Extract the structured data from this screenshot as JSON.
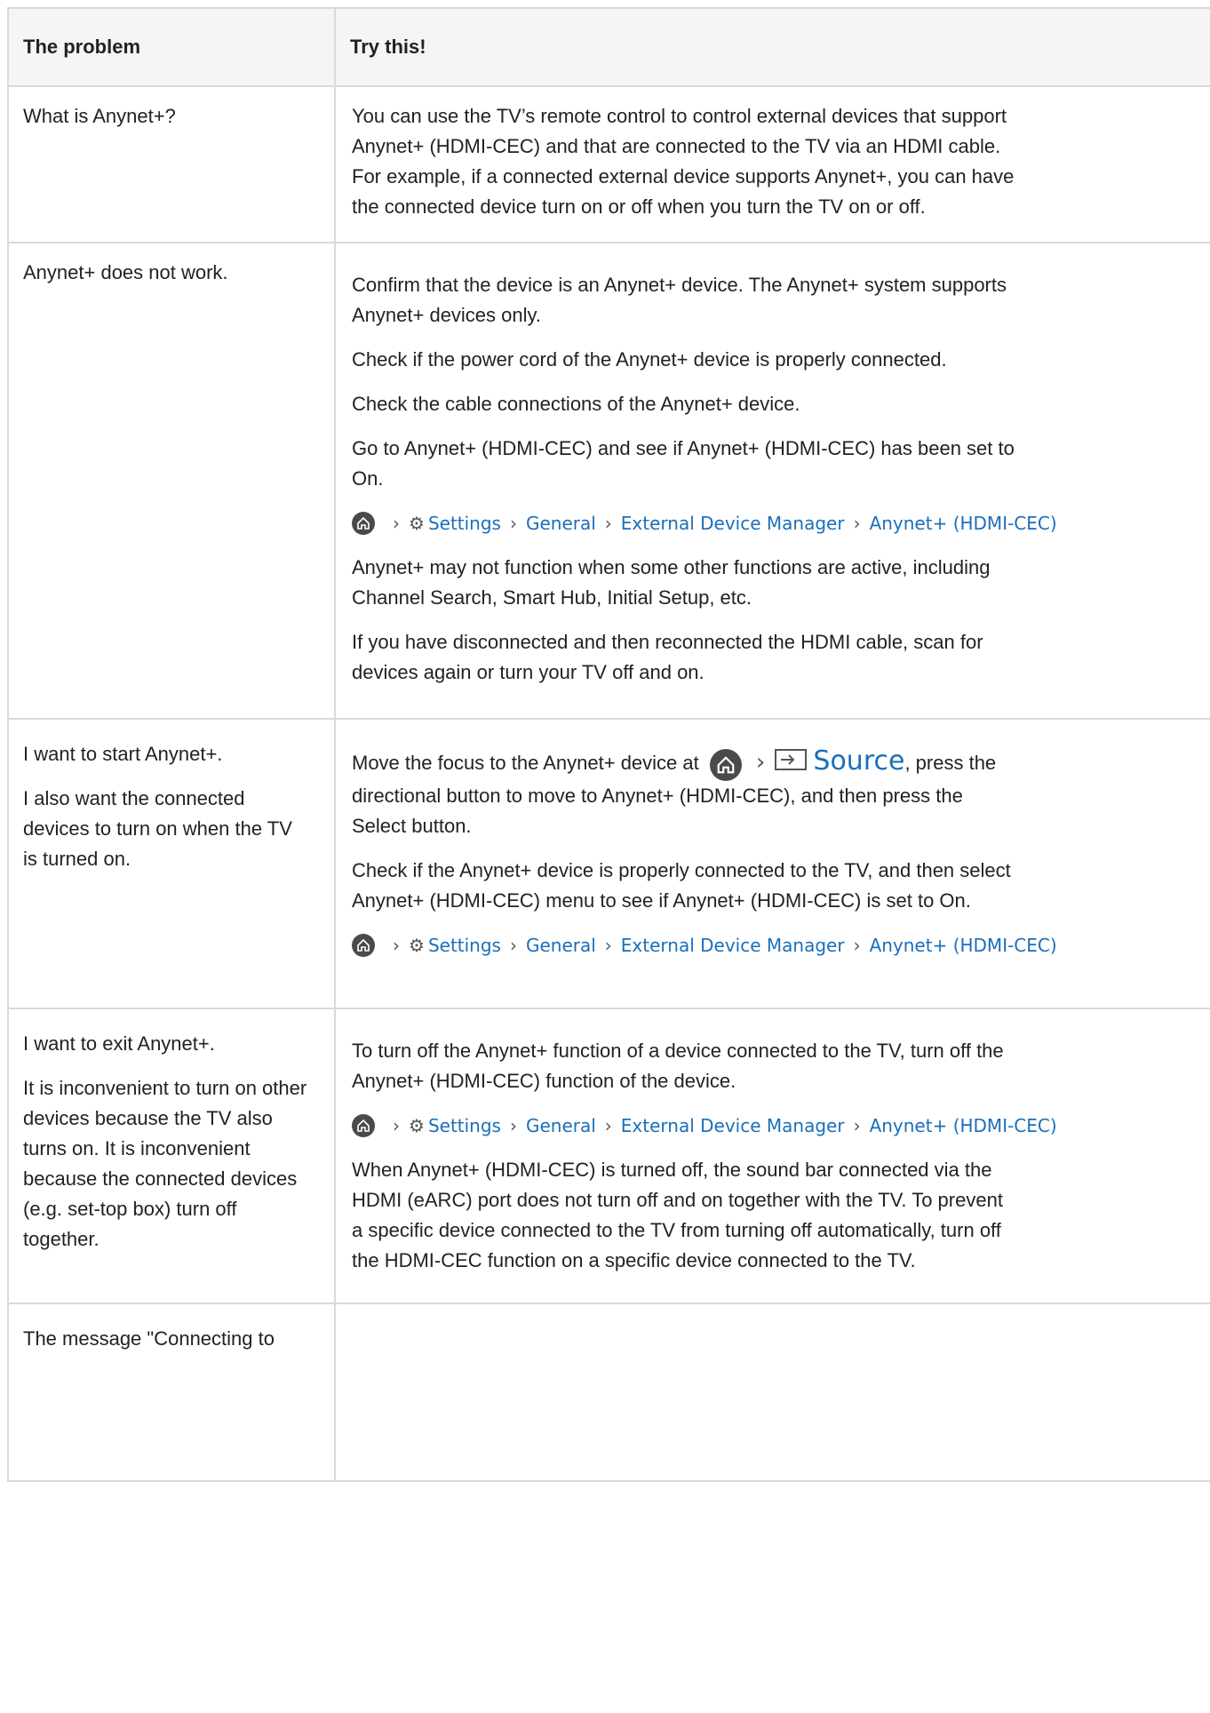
{
  "header": {
    "col1": "The problem",
    "col2": "Try this!"
  },
  "path_items": {
    "settings": "Settings",
    "general": "General",
    "edm": "External Device Manager",
    "anynet": "Anynet+ (HDMI-CEC)"
  },
  "rows": [
    {
      "problem": [
        "What is Anynet+?"
      ],
      "solution": [
        "You can use the TV’s remote control to control external devices that support",
        "Anynet+ (HDMI-CEC) and that are connected to the TV via an HDMI cable.",
        "For example, if a connected external device supports Anynet+, you can have",
        "the connected device turn on or off when you turn the TV on or off."
      ]
    },
    {
      "problem": [
        "Anynet+ does not work."
      ],
      "solution_p1": [
        "Confirm that the device is an Anynet+ device. The Anynet+ system supports",
        "Anynet+ devices only."
      ],
      "solution_p2": "Check if the power cord of the Anynet+ device is properly connected.",
      "solution_p3": "Check the cable connections of the Anynet+ device.",
      "solution_p4": [
        "Go to Anynet+ (HDMI-CEC) and see if Anynet+ (HDMI-CEC) has been set to",
        "On."
      ],
      "solution_p5": [
        "Anynet+ may not function when some other functions are active, including",
        "Channel Search, Smart Hub, Initial Setup, etc."
      ],
      "solution_p6": [
        "If you have disconnected and then reconnected the HDMI cable, scan for",
        "devices again or turn your TV off and on."
      ]
    },
    {
      "problem_p1": "I want to start Anynet+.",
      "problem_p2": [
        "I also want the connected",
        "devices to turn on when the TV",
        "is turned on."
      ],
      "solution_p1_a": "Move the focus to the Anynet+ device at",
      "source_label": "Source",
      "solution_p1_b": ", press the",
      "solution_p1_c": [
        "directional button to move to Anynet+ (HDMI-CEC), and then press the",
        "Select button."
      ],
      "solution_p2": [
        "Check if the Anynet+ device is properly connected to the TV, and then select",
        "Anynet+ (HDMI-CEC) menu to see if Anynet+ (HDMI-CEC) is set to On."
      ]
    },
    {
      "problem_p1": "I want to exit Anynet+.",
      "problem_p2": [
        "It is inconvenient to turn on other",
        "devices because the TV also",
        "turns on. It is inconvenient",
        "because the connected devices",
        "(e.g. set-top box) turn off",
        "together."
      ],
      "solution_p1": [
        "To turn off the Anynet+ function of a device connected to the TV, turn off the",
        "Anynet+ (HDMI-CEC) function of the device."
      ],
      "solution_p2": [
        "When Anynet+ (HDMI-CEC) is turned off, the sound bar connected via the",
        "HDMI (eARC) port does not turn off and on together with the TV. To prevent",
        "a specific device connected to the TV from turning off automatically, turn off",
        "the HDMI-CEC function on a specific device connected to the TV."
      ]
    },
    {
      "problem": [
        "The message \"Connecting to"
      ]
    }
  ]
}
